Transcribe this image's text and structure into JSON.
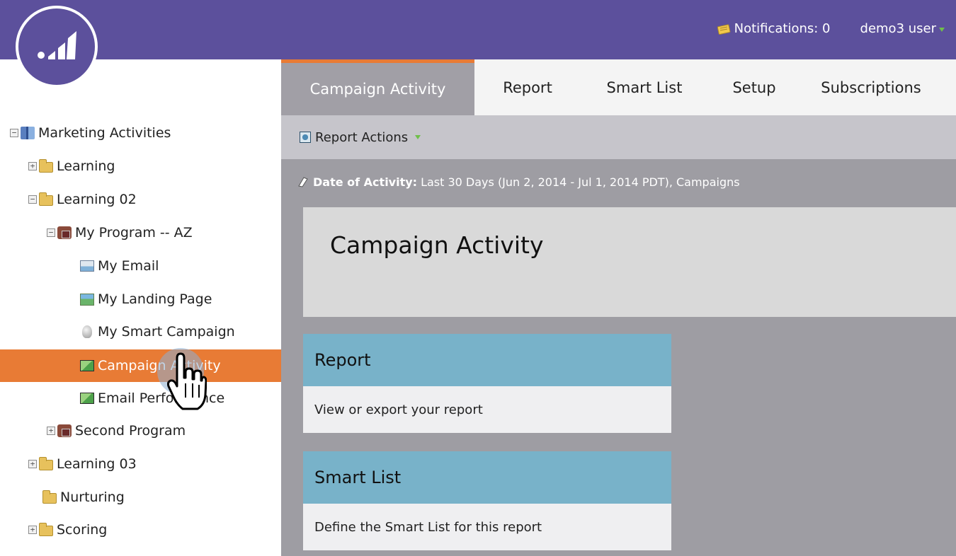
{
  "header": {
    "notifications_label": "Notifications: 0",
    "user_label": "demo3 user",
    "brand_color": "#5c509c"
  },
  "tree": {
    "items": [
      {
        "label": "Marketing Activities",
        "icon": "books-icon",
        "expander": "minus"
      },
      {
        "label": "Learning",
        "icon": "folder-icon",
        "expander": "plus"
      },
      {
        "label": "Learning 02",
        "icon": "folder-icon",
        "expander": "minus"
      },
      {
        "label": "My Program -- AZ",
        "icon": "program-icon",
        "expander": "minus"
      },
      {
        "label": "My Email",
        "icon": "email-icon"
      },
      {
        "label": "My Landing Page",
        "icon": "landing-page-icon"
      },
      {
        "label": "My Smart Campaign",
        "icon": "smart-campaign-icon"
      },
      {
        "label": "Campaign Activity",
        "icon": "report-icon",
        "selected": true
      },
      {
        "label": "Email Performance",
        "icon": "report-icon"
      },
      {
        "label": "Second Program",
        "icon": "program-icon",
        "expander": "plus"
      },
      {
        "label": "Learning 03",
        "icon": "folder-icon",
        "expander": "plus"
      },
      {
        "label": "Nurturing",
        "icon": "folder-icon"
      },
      {
        "label": "Scoring",
        "icon": "folder-icon",
        "expander": "plus"
      }
    ],
    "selected_color": "#e87b35"
  },
  "tabs": [
    {
      "label": "Campaign Activity",
      "active": true
    },
    {
      "label": "Report"
    },
    {
      "label": "Smart List"
    },
    {
      "label": "Setup"
    },
    {
      "label": "Subscriptions"
    }
  ],
  "toolbar": {
    "report_actions_label": "Report Actions"
  },
  "filter": {
    "label": "Date of Activity:",
    "value": "Last 30 Days (Jun 2, 2014 - Jul 1, 2014 PDT), Campaigns"
  },
  "page": {
    "title": "Campaign Activity"
  },
  "cards": [
    {
      "title": "Report",
      "description": "View or export your report"
    },
    {
      "title": "Smart List",
      "description": "Define the Smart List for this report"
    }
  ]
}
